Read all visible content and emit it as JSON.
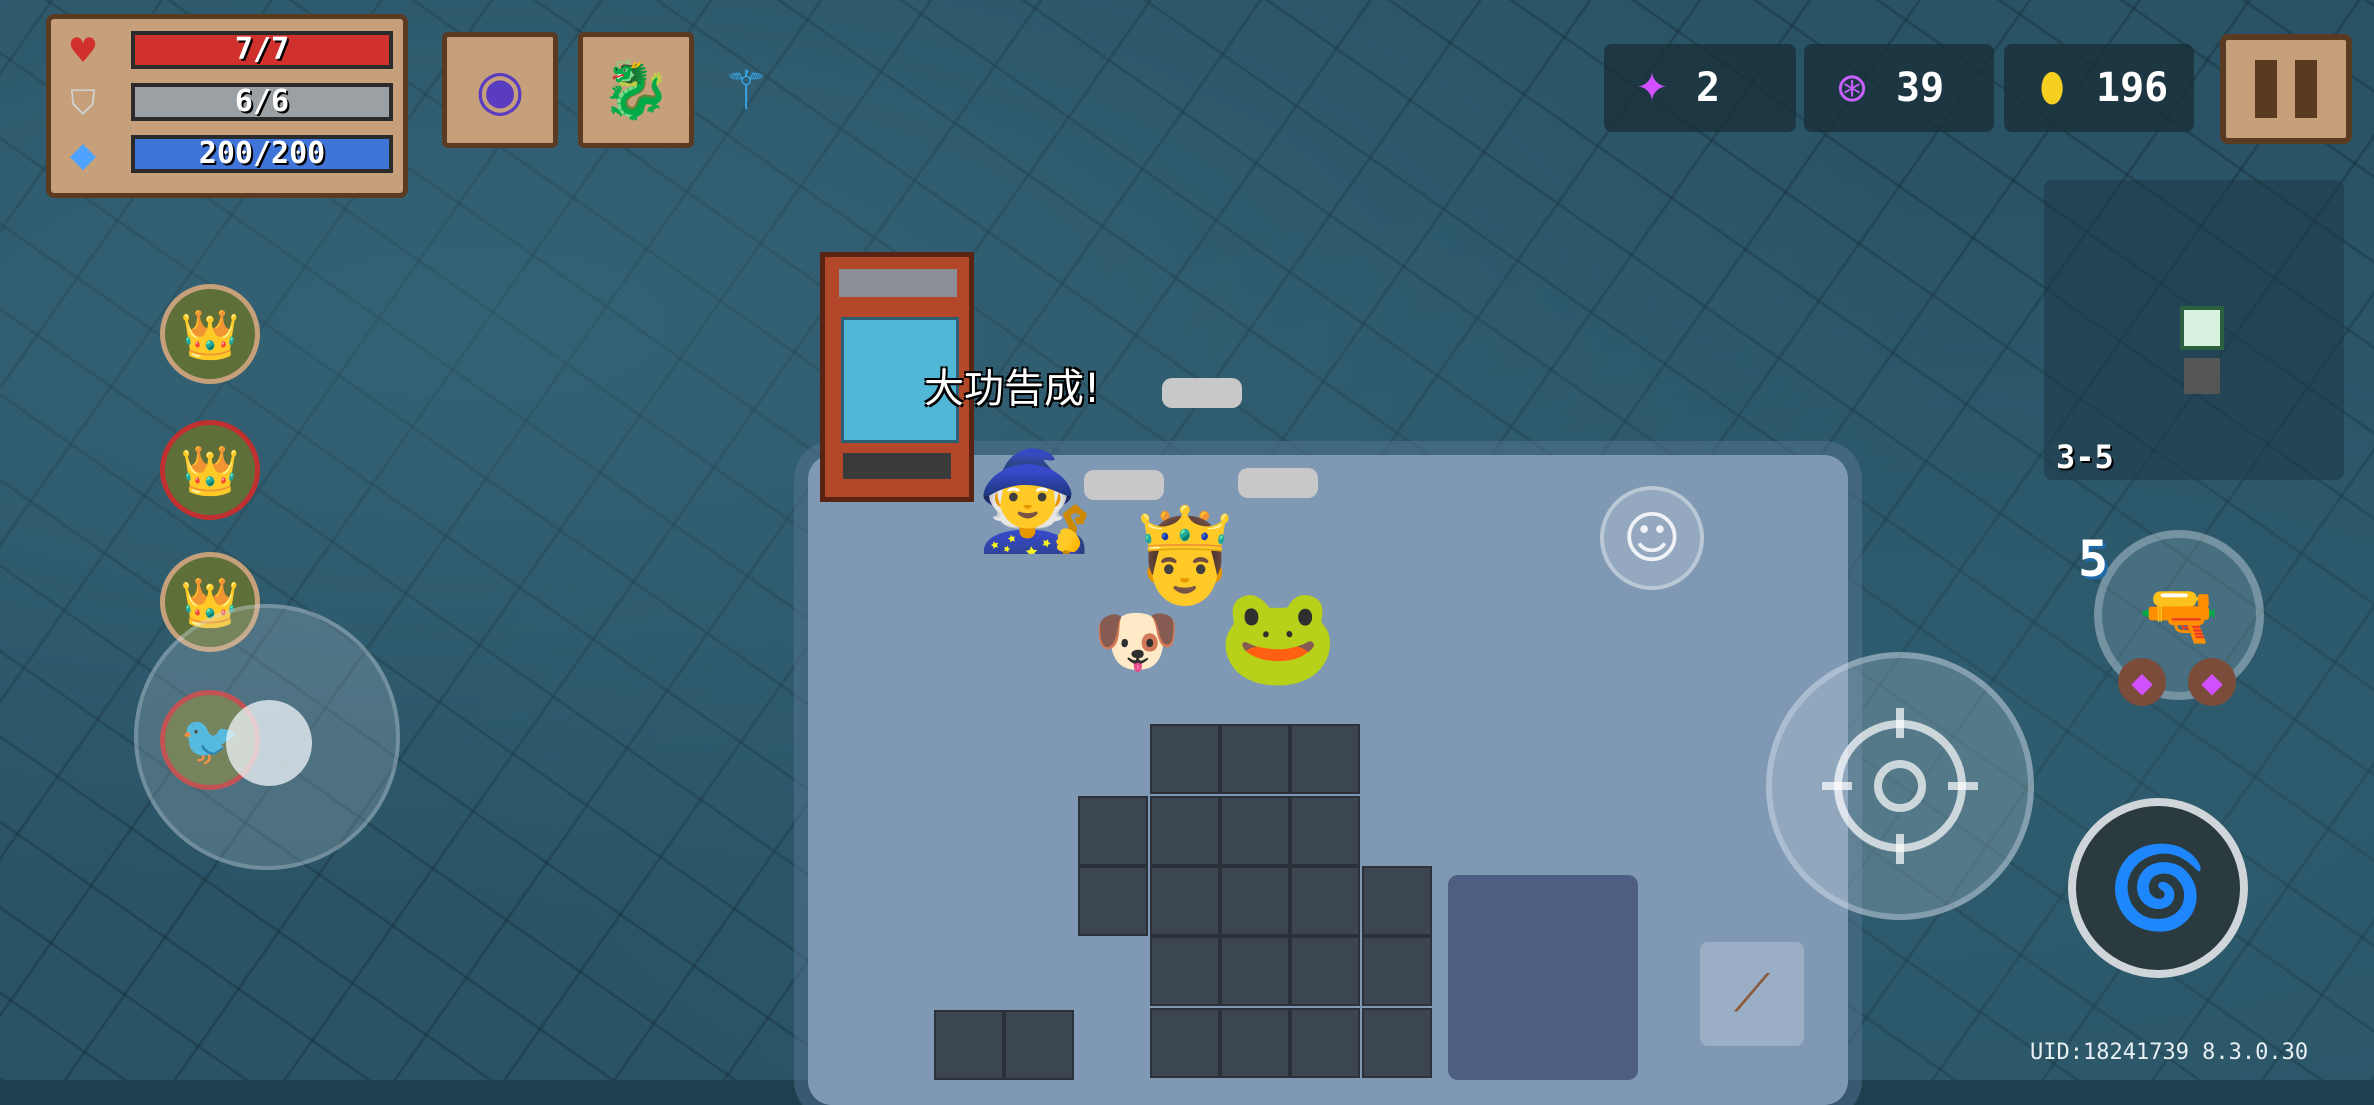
{
  "status": {
    "hp": {
      "label": "7/7",
      "current": 7,
      "max": 7,
      "icon": "heart-icon",
      "color": "#d0312d"
    },
    "armor": {
      "label": "6/6",
      "current": 6,
      "max": 6,
      "icon": "shield-icon",
      "color": "#9aa0a4"
    },
    "energy": {
      "label": "200/200",
      "current": 200,
      "max": 200,
      "icon": "diamond-icon",
      "color": "#3f74d8"
    }
  },
  "buffs": [
    "dark-orb-buff-icon",
    "green-dragon-buff-icon",
    "blue-spirit-buff-icon"
  ],
  "currency": {
    "gems": {
      "value": "2",
      "icon": "purple-star-icon"
    },
    "materials": {
      "value": "39",
      "icon": "purple-coin-icon"
    },
    "gold": {
      "value": "196",
      "icon": "gold-coin-icon"
    }
  },
  "minimap": {
    "level": "3-5"
  },
  "pets": [
    "king-pet-1",
    "king-pet-2",
    "king-pet-3",
    "blue-bird-pet"
  ],
  "popup": {
    "text": "大功告成!"
  },
  "weapon": {
    "energy_cost": "5",
    "name": "rifle-icon"
  },
  "footer": {
    "uid": "UID:18241739 8.3.0.30"
  }
}
